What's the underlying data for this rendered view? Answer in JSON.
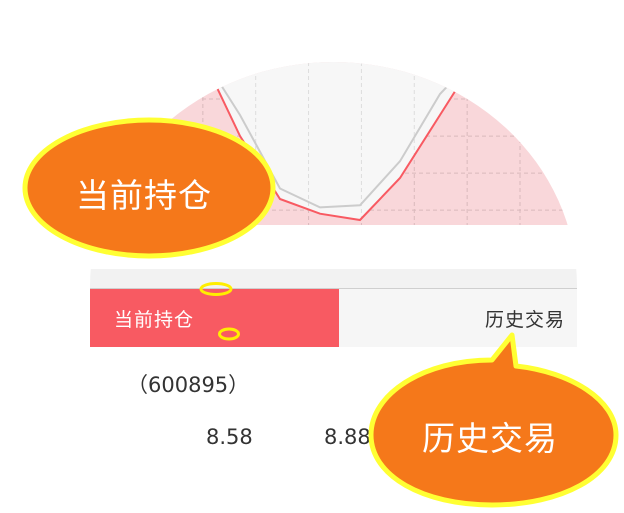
{
  "tabs": {
    "current_label": "当前持仓",
    "history_label": "历史交易",
    "active": "current"
  },
  "row": {
    "stock_code": "（600895）",
    "value_a": "8.58",
    "value_b": "8.88"
  },
  "callouts": {
    "current": "当前持仓",
    "history": "历史交易"
  },
  "colors": {
    "accent_red": "#f85a62",
    "callout_orange": "#f5781a",
    "callout_border": "#ffff33",
    "chart_fill": "#f9d7da",
    "chart_line_red": "#f85a62",
    "chart_line_gray": "#cccccc"
  },
  "chart_data": {
    "type": "line",
    "series": [
      {
        "values": [
          10,
          6,
          3,
          2.3,
          2,
          4,
          7,
          10
        ]
      },
      {
        "values": [
          10,
          7,
          3.5,
          2.6,
          2.7,
          4.8,
          8,
          10
        ]
      }
    ],
    "grid": true
  }
}
